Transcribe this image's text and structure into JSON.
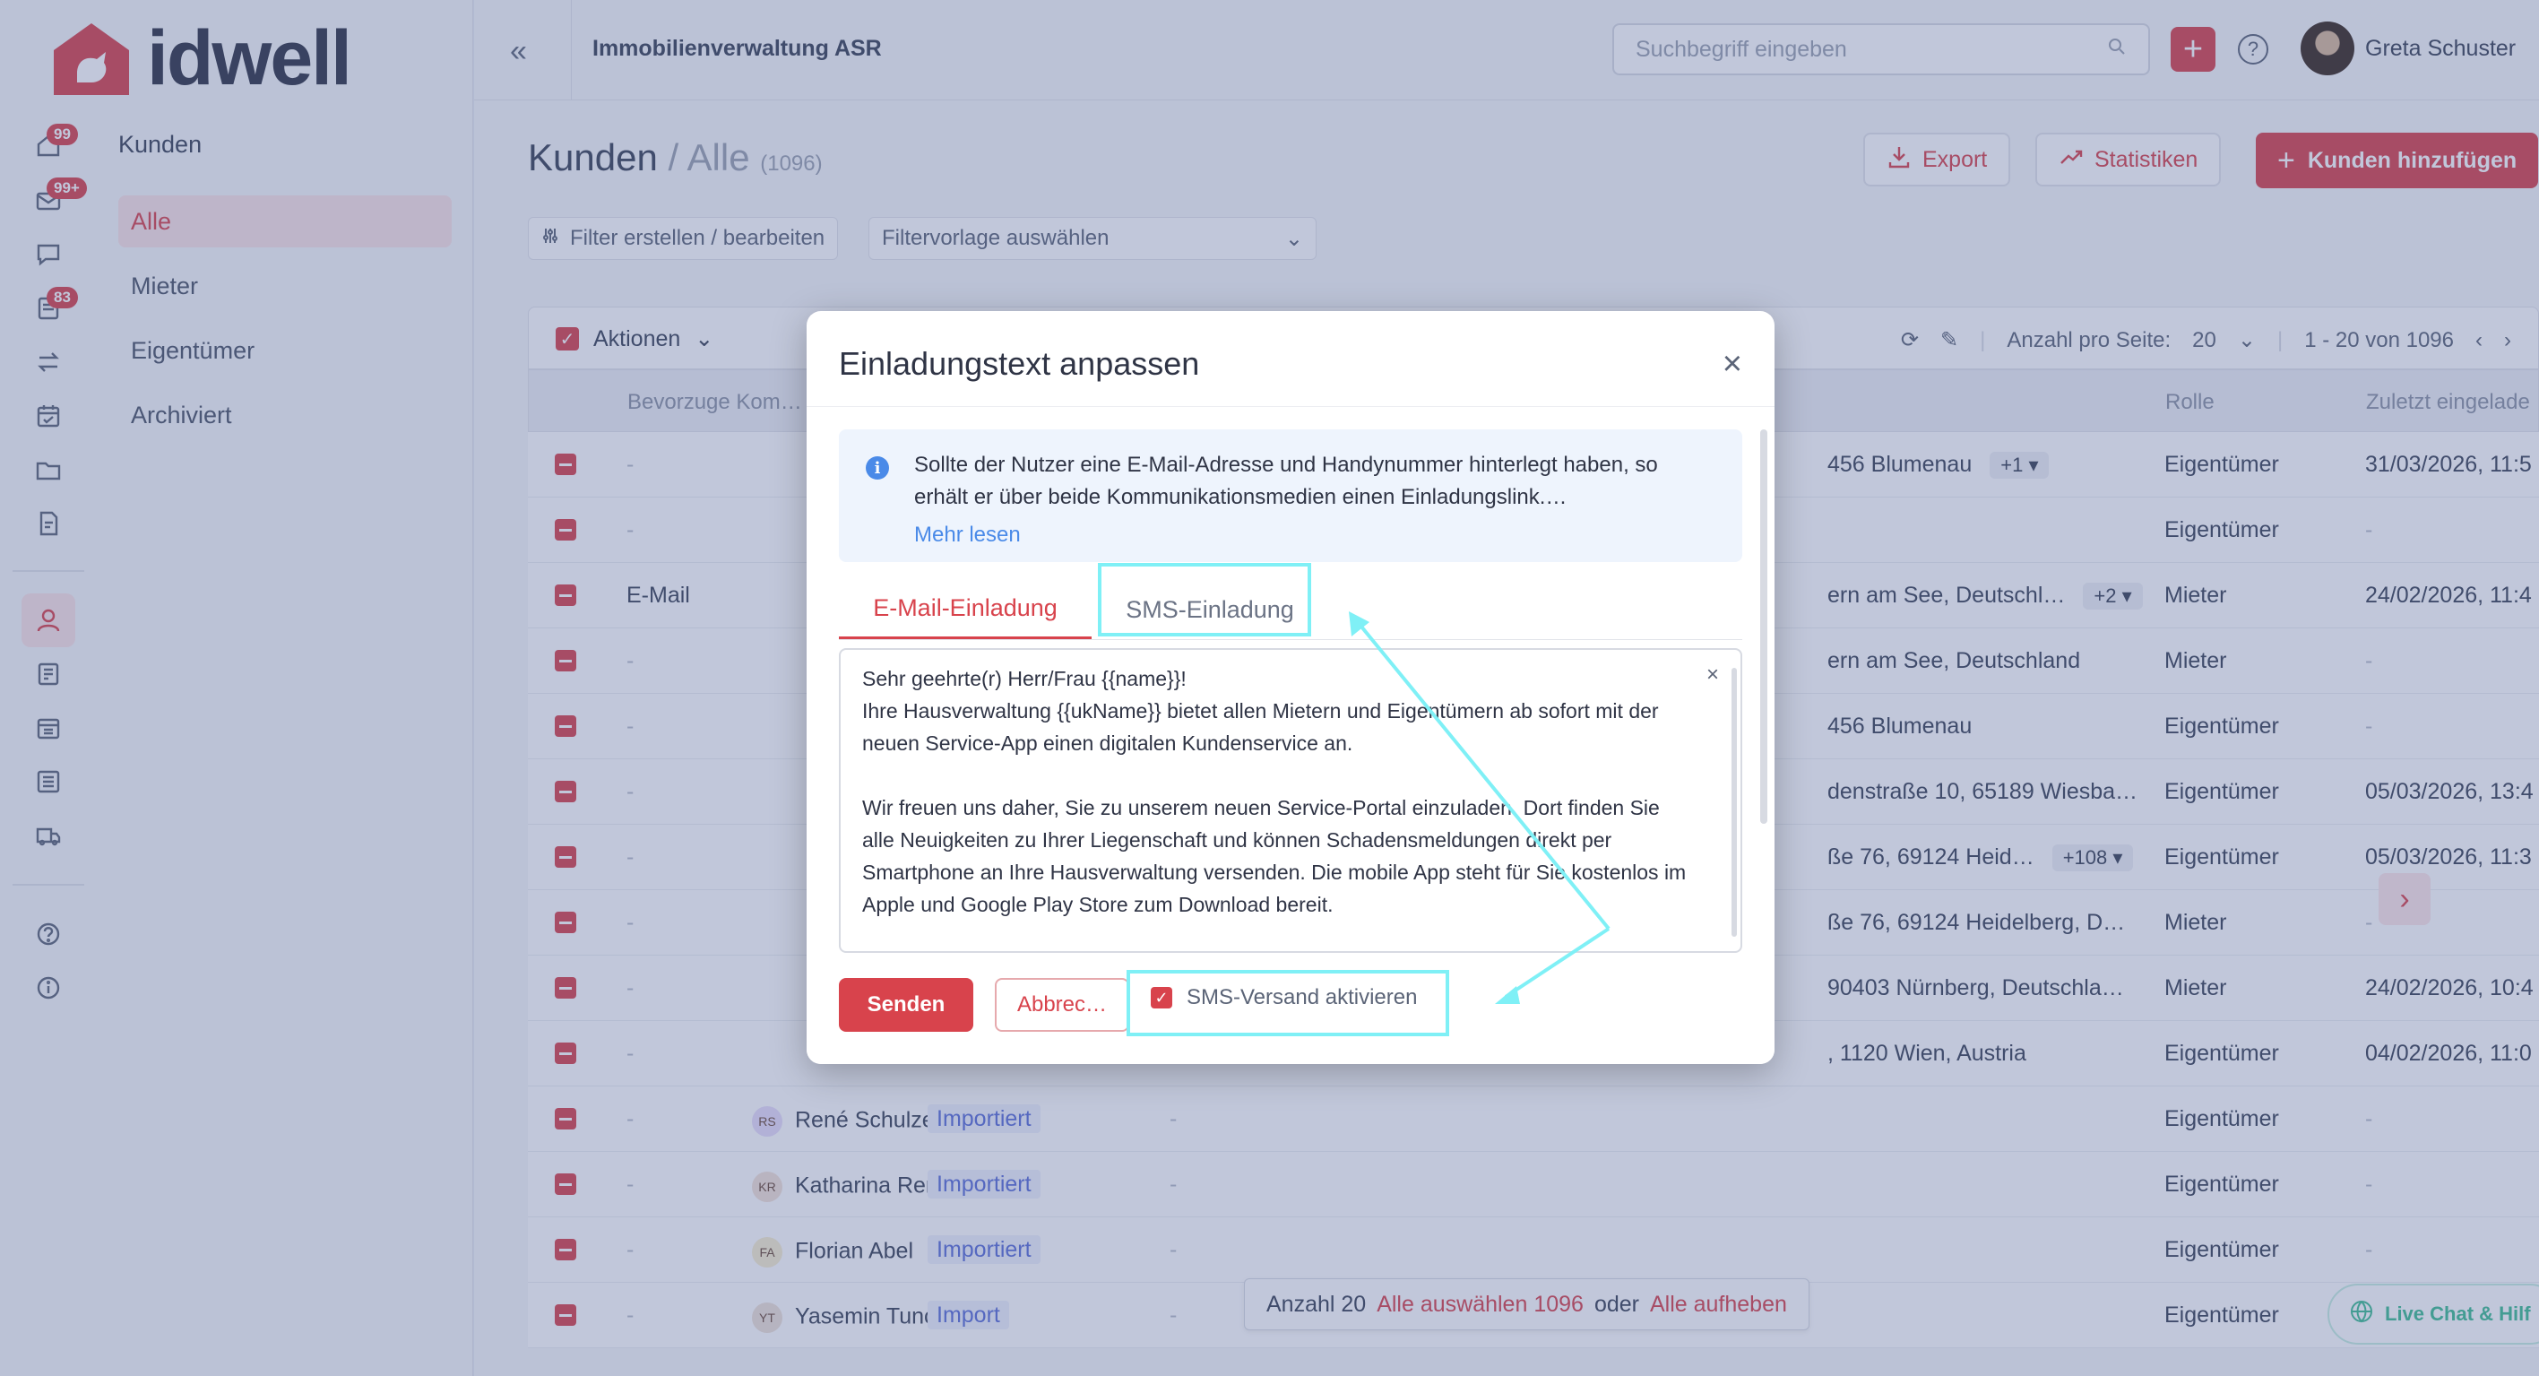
{
  "app": {
    "brand": "idwell",
    "org_name": "Immobilienverwaltung ASR",
    "user_name": "Greta Schuster",
    "search_placeholder": "Suchbegriff eingeben",
    "accent_color": "#d8434c"
  },
  "rail": {
    "badges": [
      "99",
      "99+",
      "83"
    ],
    "icons": [
      "home-icon",
      "mail-icon",
      "chat-icon",
      "tickets-icon",
      "transfer-icon",
      "calendar-icon",
      "folder-icon",
      "document-icon",
      "user-icon",
      "building-icon",
      "property-icon",
      "list-icon",
      "truck-icon",
      "help-icon",
      "info-icon"
    ]
  },
  "nav": {
    "title": "Kunden",
    "items": [
      "Alle",
      "Mieter",
      "Eigentümer",
      "Archiviert"
    ]
  },
  "page": {
    "title_main": "Kunden",
    "title_sep": " / ",
    "title_sub": "Alle",
    "count": "(1096)",
    "export_label": "Export",
    "stats_label": "Statistiken",
    "add_label": "Kunden hinzufügen",
    "filter_label": "Filter erstellen / bearbeiten",
    "filter_template": "Filtervorlage auswählen"
  },
  "toolbar": {
    "actions_label": "Aktionen",
    "per_page_label": "Anzahl pro Seite:",
    "per_page_value": "20",
    "range": "1 - 20 von 1096"
  },
  "table": {
    "headers": [
      "Bevorzuge Kom…",
      "Rolle",
      "Zuletzt eingelade"
    ],
    "rows": [
      {
        "kom": "-",
        "name": "",
        "initials": "",
        "status": "",
        "addr": "456 Blumenau",
        "more": "+1",
        "role": "Eigentümer",
        "date": "31/03/2026, 11:5"
      },
      {
        "kom": "-",
        "name": "",
        "initials": "",
        "status": "",
        "addr": "",
        "more": "",
        "role": "Eigentümer",
        "date": "-"
      },
      {
        "kom": "E-Mail",
        "name": "",
        "initials": "",
        "status": "",
        "addr": "ern am See, Deutschl…",
        "more": "+2",
        "role": "Mieter",
        "date": "24/02/2026, 11:4"
      },
      {
        "kom": "-",
        "name": "",
        "initials": "",
        "status": "",
        "addr": "ern am See, Deutschland",
        "more": "",
        "role": "Mieter",
        "date": "-"
      },
      {
        "kom": "-",
        "name": "",
        "initials": "",
        "status": "",
        "addr": "456 Blumenau",
        "more": "",
        "role": "Eigentümer",
        "date": "-"
      },
      {
        "kom": "-",
        "name": "",
        "initials": "",
        "status": "",
        "addr": "denstraße 10, 65189 Wiesba…",
        "more": "",
        "role": "Eigentümer",
        "date": "05/03/2026, 13:4"
      },
      {
        "kom": "-",
        "name": "",
        "initials": "",
        "status": "",
        "addr": "ße 76, 69124 Heid…",
        "more": "+108",
        "role": "Eigentümer",
        "date": "05/03/2026, 11:3"
      },
      {
        "kom": "-",
        "name": "",
        "initials": "",
        "status": "",
        "addr": "ße 76, 69124 Heidelberg, D…",
        "more": "",
        "role": "Mieter",
        "date": "-"
      },
      {
        "kom": "-",
        "name": "",
        "initials": "",
        "status": "",
        "addr": "90403 Nürnberg, Deutschla…",
        "more": "",
        "role": "Mieter",
        "date": "24/02/2026, 10:4"
      },
      {
        "kom": "-",
        "name": "",
        "initials": "",
        "status": "",
        "addr": ", 1120 Wien, Austria",
        "more": "",
        "role": "Eigentümer",
        "date": "04/02/2026, 11:0"
      },
      {
        "kom": "-",
        "name": "René Schulze",
        "initials": "RS",
        "status": "Importiert",
        "addr": "-",
        "more": "",
        "role": "Eigentümer",
        "date": "-"
      },
      {
        "kom": "-",
        "name": "Katharina Renz",
        "initials": "KR",
        "status": "Importiert",
        "addr": "-",
        "more": "",
        "role": "Eigentümer",
        "date": "-"
      },
      {
        "kom": "-",
        "name": "Florian Abel",
        "initials": "FA",
        "status": "Importiert",
        "addr": "-",
        "more": "",
        "role": "Eigentümer",
        "date": "-"
      },
      {
        "kom": "-",
        "name": "Yasemin Tunc",
        "initials": "YT",
        "status": "Import",
        "addr": "-",
        "more": "",
        "role": "Eigentümer",
        "date": "-"
      }
    ]
  },
  "selection": {
    "count_label": "Anzahl 20",
    "select_all": "Alle auswählen 1096",
    "or": "oder",
    "clear_all": "Alle aufheben"
  },
  "chat_label": "Live Chat & Hilf",
  "modal": {
    "title": "Einladungstext anpassen",
    "info_text": "Sollte der Nutzer eine E-Mail-Adresse und Handynummer hinterlegt haben, so erhält er über beide Kommunikationsmedien einen Einladungslink.…",
    "info_link": "Mehr lesen",
    "tab_email": "E-Mail-Einladung",
    "tab_sms": "SMS-Einladung",
    "body_lines": [
      "Sehr geehrte(r) Herr/Frau {{name}}!",
      "Ihre Hausverwaltung {{ukName}} bietet allen Mietern und Eigentümern ab sofort mit der neuen Service-App einen digitalen Kundenservice an.",
      "",
      "Wir freuen uns daher, Sie zu unserem neuen Service-Portal einzuladen. Dort finden Sie alle Neuigkeiten zu Ihrer Liegenschaft und können Schadensmeldungen direkt per Smartphone an Ihre Hausverwaltung versenden. Die mobile App steht für Sie kostenlos im Apple und Google Play Store zum Download bereit."
    ],
    "send_label": "Senden",
    "cancel_label": "Abbrec…",
    "sms_toggle_label": "SMS-Versand aktivieren",
    "sms_toggle_checked": true
  },
  "annotation_color": "#7ff0f6"
}
